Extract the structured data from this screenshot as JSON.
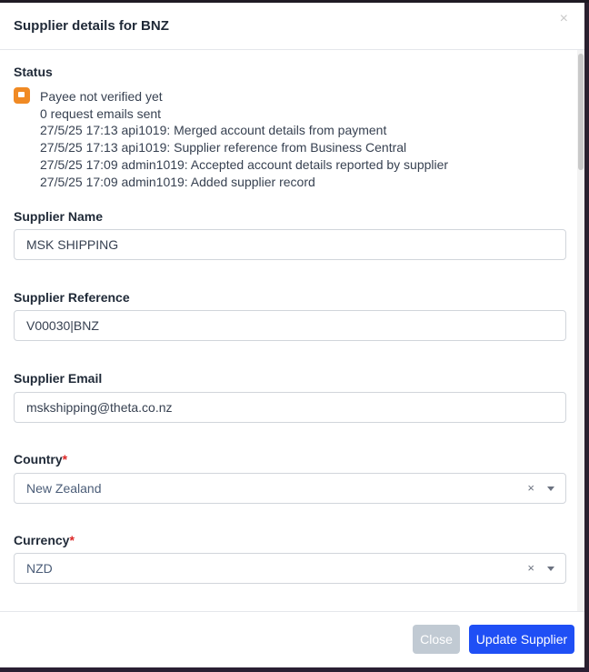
{
  "modal": {
    "title": "Supplier details for BNZ",
    "close_symbol": "×"
  },
  "status": {
    "heading": "Status",
    "icon": "payee-status-icon",
    "lines": [
      "Payee not verified yet",
      "0 request emails sent",
      "27/5/25 17:13 api1019: Merged account details from payment",
      "27/5/25 17:13 api1019: Supplier reference from Business Central",
      "27/5/25 17:09 admin1019: Accepted account details reported by supplier",
      "27/5/25 17:09 admin1019: Added supplier record"
    ]
  },
  "fields": {
    "supplier_name": {
      "label": "Supplier Name",
      "value": "MSK SHIPPING"
    },
    "supplier_reference": {
      "label": "Supplier Reference",
      "value": "V00030|BNZ"
    },
    "supplier_email": {
      "label": "Supplier Email",
      "value": "mskshipping@theta.co.nz"
    },
    "country": {
      "label": "Country",
      "required_mark": "*",
      "value": "New Zealand",
      "clear_symbol": "×"
    },
    "currency": {
      "label": "Currency",
      "required_mark": "*",
      "value": "NZD",
      "clear_symbol": "×"
    }
  },
  "footer": {
    "close_label": "Close",
    "update_label": "Update Supplier"
  },
  "colors": {
    "primary": "#1f4ff5",
    "disabled": "#c1cad3",
    "status_warning": "#f08a24",
    "required": "#dc2626"
  }
}
